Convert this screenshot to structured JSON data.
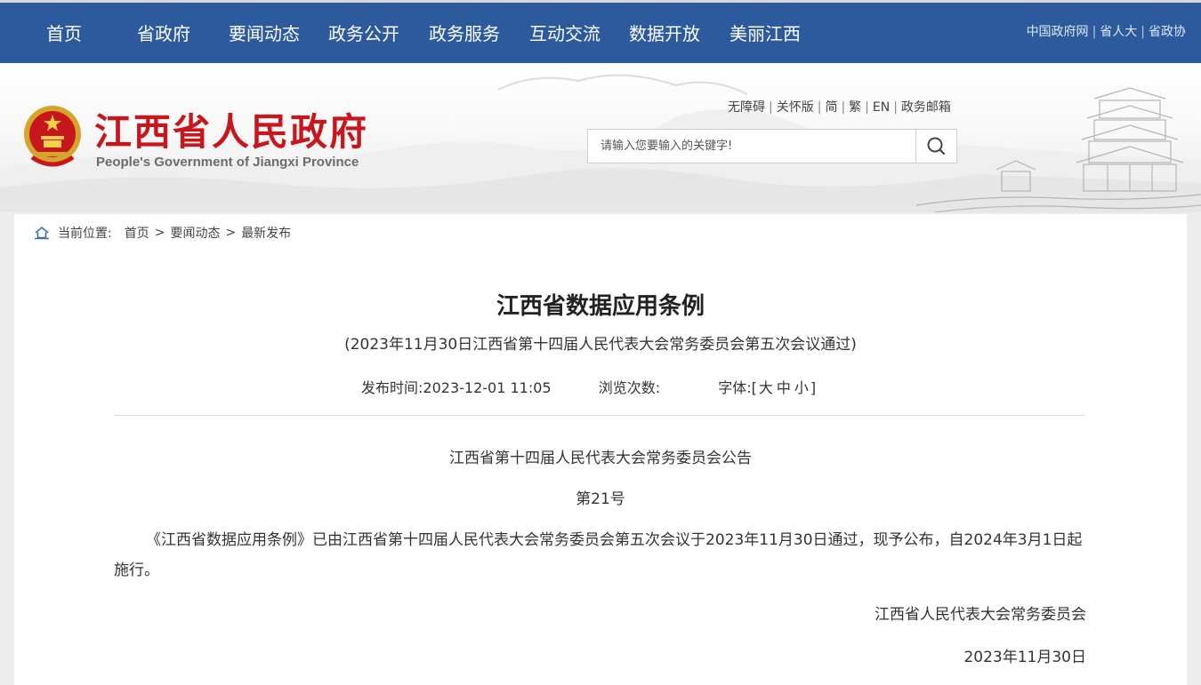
{
  "topnav": {
    "items": [
      "首页",
      "省政府",
      "要闻动态",
      "政务公开",
      "政务服务",
      "互动交流",
      "数据开放",
      "美丽江西"
    ],
    "links": [
      "中国政府网",
      "省人大",
      "省政协"
    ]
  },
  "header": {
    "title": "江西省人民政府",
    "subtitle": "People's Government of Jiangxi Province",
    "utility_links": [
      "无障碍",
      "关怀版",
      "简",
      "繁",
      "EN",
      "政务邮箱"
    ],
    "search_placeholder": "请输入您要输入的关键字!"
  },
  "breadcrumb": {
    "label": "当前位置:",
    "items": [
      "首页",
      "要闻动态",
      "最新发布"
    ]
  },
  "article": {
    "title": "江西省数据应用条例",
    "subtitle": "(2023年11月30日江西省第十四届人民代表大会常务委员会第五次会议通过)",
    "publish_time_label": "发布时间:",
    "publish_time": "2023-12-01 11:05",
    "views_label": "浏览次数:",
    "views_value": "",
    "font_label": "字体:",
    "font_open": "[",
    "font_options": [
      "大",
      "中",
      "小"
    ],
    "font_close": "]",
    "announcement_title": "江西省第十四届人民代表大会常务委员会公告",
    "announcement_number": "第21号",
    "body": "《江西省数据应用条例》已由江西省第十四届人民代表大会常务委员会第五次会议于2023年11月30日通过，现予公布，自2024年3月1日起施行。",
    "signature": "江西省人民代表大会常务委员会",
    "date": "2023年11月30日"
  },
  "colors": {
    "nav_bg": "#2c5a9c",
    "logo_red": "#c8161d"
  }
}
